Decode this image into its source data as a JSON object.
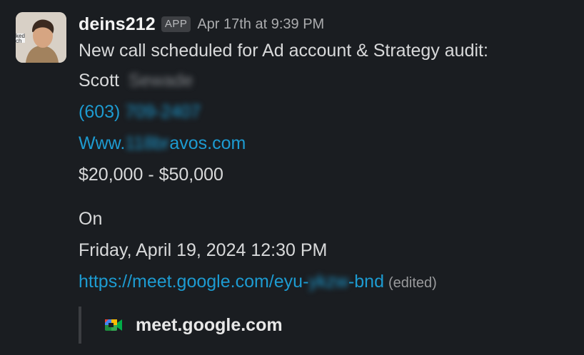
{
  "message": {
    "sender": "deins212",
    "badge": "APP",
    "timestamp": "Apr 17th at 9:39 PM",
    "lines": {
      "headline": "New call scheduled for Ad account & Strategy audit:",
      "name_first": "Scott",
      "name_last_redacted": "Sewade",
      "phone_prefix": "(603)",
      "phone_rest_redacted": "709-2407",
      "website_prefix": "Www.",
      "website_middle_redacted": "118br",
      "website_suffix": "avos.com",
      "budget": "$20,000 - $50,000",
      "on_label": "On",
      "datetime": "Friday, April 19, 2024 12:30 PM",
      "meet_link_prefix": "https://meet.google.com/eyu-",
      "meet_link_middle_redacted": "ykzw",
      "meet_link_suffix": "-bnd",
      "edited": "(edited)"
    },
    "unfurl": {
      "icon": "google-meet-icon",
      "title": "meet.google.com"
    }
  },
  "colors": {
    "background": "#1a1d21",
    "link": "#1d9bd1",
    "text": "#d1d2d3"
  }
}
